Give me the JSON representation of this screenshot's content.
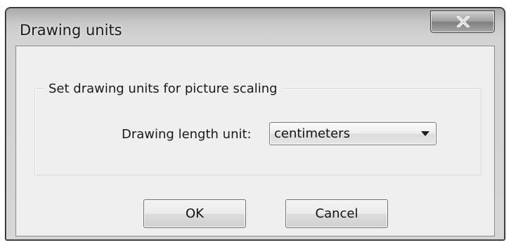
{
  "window": {
    "title": "Drawing units",
    "close_icon": "close-icon"
  },
  "group": {
    "legend": "Set drawing units for picture scaling"
  },
  "unit_field": {
    "label": "Drawing length unit:",
    "selected_value": "centimeters",
    "arrow_icon": "dropdown-arrow-icon"
  },
  "buttons": {
    "ok_label": "OK",
    "cancel_label": "Cancel"
  },
  "colors": {
    "title_bar": "#a9a9a9",
    "client_background": "#efefef",
    "close_button": "#9e9e9e"
  }
}
